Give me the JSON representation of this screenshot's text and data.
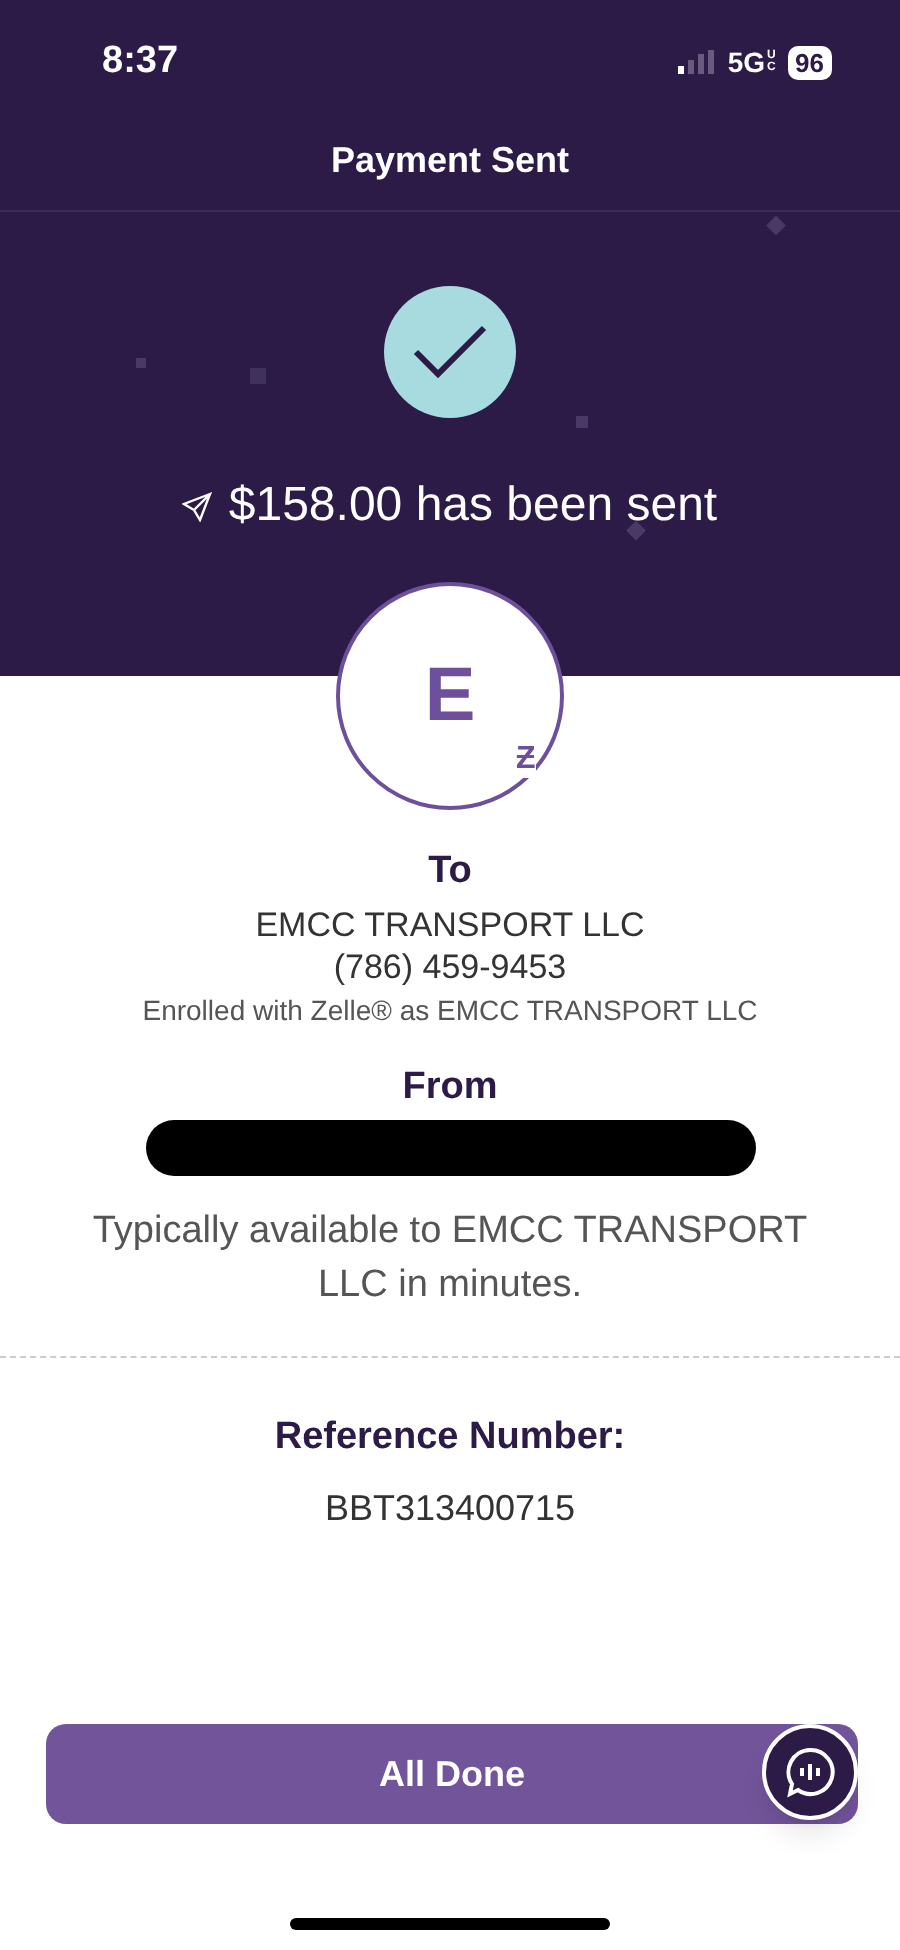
{
  "status_bar": {
    "time": "8:37",
    "network": "5G",
    "network_suffix": "UC",
    "battery": "96"
  },
  "header": {
    "title": "Payment Sent",
    "amount_message": "$158.00 has been sent"
  },
  "recipient": {
    "initial": "E",
    "badge": "Ƶ",
    "label": "To",
    "name": "EMCC TRANSPORT LLC",
    "phone": "(786) 459-9453",
    "enrolled": "Enrolled with Zelle® as EMCC TRANSPORT LLC"
  },
  "sender": {
    "label": "From"
  },
  "availability": "Typically available to EMCC TRANSPORT LLC in minutes.",
  "reference": {
    "label": "Reference Number:",
    "value": "BBT313400715"
  },
  "button": {
    "label": "All Done"
  }
}
